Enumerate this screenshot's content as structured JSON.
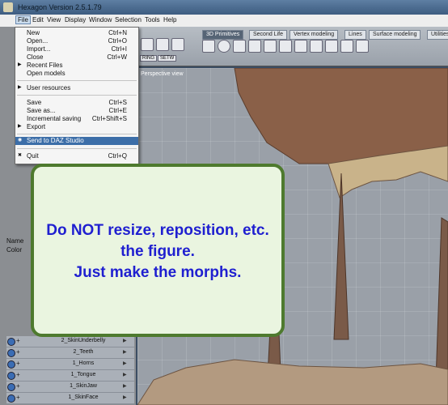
{
  "window": {
    "title": "Hexagon Version 2.5.1.79"
  },
  "menubar": [
    "File",
    "Edit",
    "View",
    "Display",
    "Window",
    "Selection",
    "Tools",
    "Help"
  ],
  "file_menu": [
    {
      "label": "New",
      "shortcut": "Ctrl+N"
    },
    {
      "label": "Open...",
      "shortcut": "Ctrl+O"
    },
    {
      "label": "Import...",
      "shortcut": "Ctrl+I"
    },
    {
      "label": "Close",
      "shortcut": "Ctrl+W"
    },
    {
      "label": "Recent Files",
      "shortcut": ""
    },
    {
      "label": "Open models",
      "shortcut": ""
    },
    {
      "label": "User resources",
      "shortcut": ""
    },
    {
      "label": "Save",
      "shortcut": "Ctrl+S"
    },
    {
      "label": "Save as...",
      "shortcut": "Ctrl+E"
    },
    {
      "label": "Incremental saving",
      "shortcut": "Ctrl+Shift+S"
    },
    {
      "label": "Export",
      "shortcut": ""
    },
    {
      "label": "Send to DAZ Studio",
      "shortcut": ""
    },
    {
      "label": "Quit",
      "shortcut": "Ctrl+Q"
    }
  ],
  "toolbar": {
    "ring_label": "RING",
    "setw_label": "SETW"
  },
  "tabs": [
    "3D Primitives",
    "Second Life",
    "Vertex modeling",
    "Lines",
    "Surface modeling",
    "Utilities"
  ],
  "viewport": {
    "label": "Perspective view"
  },
  "properties": {
    "name_label": "Name",
    "color_label": "Color"
  },
  "layers": [
    "2_SkinUnderbelly",
    "2_Teeth",
    "1_Horns",
    "1_Tongue",
    "1_SkinJaw",
    "1_SkinFace"
  ],
  "callout": {
    "line1": "Do NOT resize, reposition, etc.",
    "line2": "the figure.",
    "line3": "Just make the morphs."
  },
  "colors": {
    "highlight": "#3c6ea8",
    "callout_border": "#4e7a2e",
    "callout_text": "#1f1fd0"
  }
}
